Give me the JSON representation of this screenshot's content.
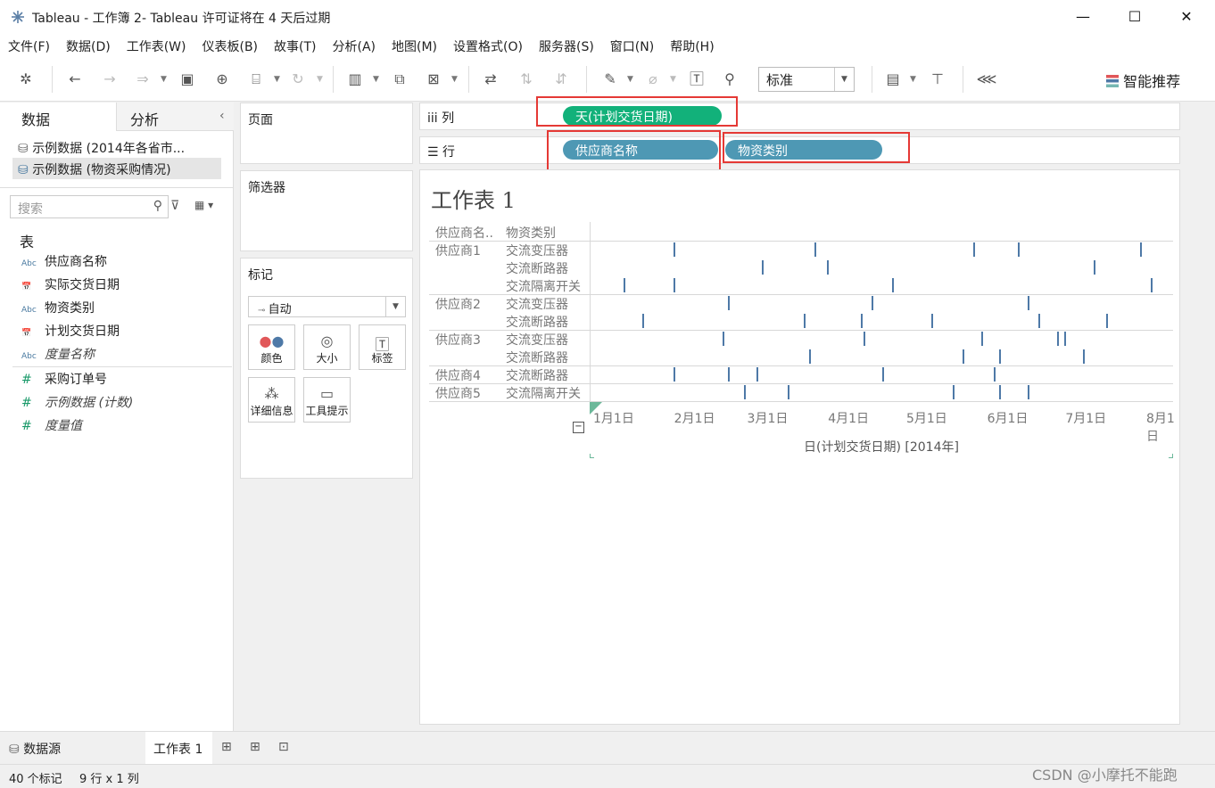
{
  "window": {
    "title": "Tableau - 工作簿 2- Tableau 许可证将在 4 天后过期",
    "minimize": "—",
    "maximize": "☐",
    "close": "✕"
  },
  "menu": [
    "文件(F)",
    "数据(D)",
    "工作表(W)",
    "仪表板(B)",
    "故事(T)",
    "分析(A)",
    "地图(M)",
    "设置格式(O)",
    "服务器(S)",
    "窗口(N)",
    "帮助(H)"
  ],
  "toolbar": {
    "fit_select": "标准",
    "smart": "智能推荐"
  },
  "data_pane": {
    "tabs": [
      "数据",
      "分析"
    ],
    "datasources": [
      "示例数据 (2014年各省市...",
      "示例数据 (物资采购情况)"
    ],
    "search_placeholder": "搜索",
    "tables_header": "表",
    "dimensions": [
      {
        "icon": "Abc",
        "label": "供应商名称"
      },
      {
        "icon": "📅",
        "label": "实际交货日期"
      },
      {
        "icon": "Abc",
        "label": "物资类别"
      },
      {
        "icon": "📅",
        "label": "计划交货日期"
      },
      {
        "icon": "Abc",
        "label": "度量名称"
      }
    ],
    "measures": [
      {
        "icon": "#",
        "label": "采购订单号"
      },
      {
        "icon": "#",
        "label": "示例数据 (计数)"
      },
      {
        "icon": "#",
        "label": "度量值"
      }
    ]
  },
  "cards": {
    "pages": "页面",
    "filters": "筛选器",
    "marks": "标记",
    "mark_type": "自动",
    "mark_buttons": [
      "颜色",
      "大小",
      "标签",
      "详细信息",
      "工具提示"
    ]
  },
  "shelves": {
    "columns_label": "列",
    "rows_label": "行",
    "column_pill": "天(计划交货日期)",
    "row_pills": [
      "供应商名称",
      "物资类别"
    ]
  },
  "sheet": {
    "title": "工作表 1",
    "row_header_1": "供应商名..",
    "row_header_2": "物资类别",
    "axis_title": "日(计划交货日期) [2014年]"
  },
  "chart_data": {
    "type": "scatter",
    "mark": "tick",
    "x_axis": {
      "label": "日(计划交货日期) [2014年]",
      "ticks": [
        "1月1日",
        "2月1日",
        "3月1日",
        "4月1日",
        "5月1日",
        "6月1日",
        "7月1日",
        "8月1日"
      ],
      "range": [
        "2014-01-01",
        "2014-08-01"
      ]
    },
    "rows": [
      {
        "supplier": "供应商1",
        "category": "交流变压器",
        "dates": [
          "2014-01-31",
          "2014-03-26",
          "2014-05-26",
          "2014-06-12",
          "2014-07-29"
        ]
      },
      {
        "supplier": "",
        "category": "交流断路器",
        "dates": [
          "2014-03-06",
          "2014-03-31",
          "2014-07-11"
        ]
      },
      {
        "supplier": "",
        "category": "交流隔离开关",
        "dates": [
          "2014-01-12",
          "2014-01-31",
          "2014-04-25",
          "2014-08-02"
        ]
      },
      {
        "supplier": "供应商2",
        "category": "交流变压器",
        "dates": [
          "2014-02-21",
          "2014-04-17",
          "2014-06-16"
        ]
      },
      {
        "supplier": "",
        "category": "交流断路器",
        "dates": [
          "2014-01-19",
          "2014-03-22",
          "2014-04-13",
          "2014-05-10",
          "2014-06-20",
          "2014-07-16"
        ]
      },
      {
        "supplier": "供应商3",
        "category": "交流变压器",
        "dates": [
          "2014-02-19",
          "2014-04-14",
          "2014-05-29",
          "2014-06-27",
          "2014-06-30"
        ]
      },
      {
        "supplier": "",
        "category": "交流断路器",
        "dates": [
          "2014-03-24",
          "2014-05-22",
          "2014-06-05",
          "2014-07-07"
        ]
      },
      {
        "supplier": "供应商4",
        "category": "交流断路器",
        "dates": [
          "2014-01-31",
          "2014-02-21",
          "2014-03-04",
          "2014-04-21",
          "2014-06-03"
        ]
      },
      {
        "supplier": "供应商5",
        "category": "交流隔离开关",
        "dates": [
          "2014-02-27",
          "2014-03-16",
          "2014-05-18",
          "2014-06-05",
          "2014-06-16"
        ]
      }
    ]
  },
  "bottom": {
    "datasource_tab": "数据源",
    "sheet_tab": "工作表 1"
  },
  "status": {
    "marks": "40 个标记",
    "dims": "9 行 x 1 列"
  },
  "watermark": "CSDN @小摩托不能跑"
}
